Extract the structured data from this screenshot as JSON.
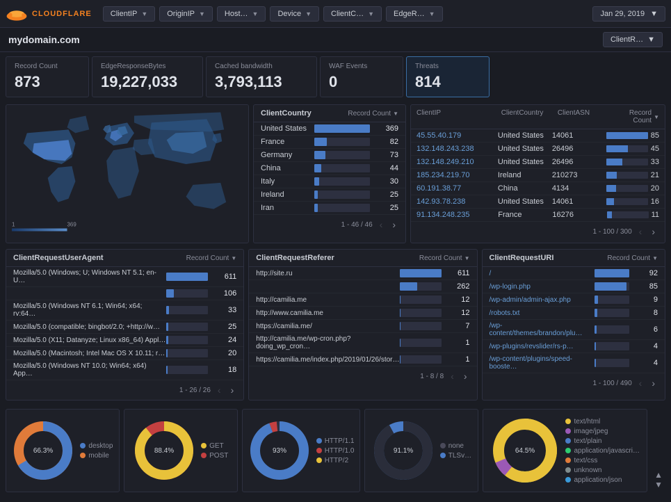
{
  "nav": {
    "logo_text": "CLOUDFLARE",
    "filters": [
      {
        "label": "ClientIP",
        "id": "clientip"
      },
      {
        "label": "OriginIP",
        "id": "originip"
      },
      {
        "label": "Host…",
        "id": "host"
      },
      {
        "label": "Device",
        "id": "device"
      },
      {
        "label": "ClientC…",
        "id": "clientc"
      },
      {
        "label": "EdgeR…",
        "id": "edger"
      }
    ],
    "date": "Jan 29, 2019"
  },
  "domain": {
    "title": "mydomain.com",
    "clientr_label": "ClientR…"
  },
  "metrics": [
    {
      "label": "Record Count",
      "value": "873",
      "highlight": false
    },
    {
      "label": "EdgeResponseBytes",
      "value": "19,227,033",
      "highlight": false
    },
    {
      "label": "Cached bandwidth",
      "value": "3,793,113",
      "highlight": false
    },
    {
      "label": "WAF Events",
      "value": "0",
      "highlight": false
    },
    {
      "label": "Threats",
      "value": "814",
      "highlight": true
    }
  ],
  "country_table": {
    "title": "ClientCountry",
    "col_header": "Record Count",
    "rows": [
      {
        "label": "United States",
        "value": 369,
        "max": 369
      },
      {
        "label": "France",
        "value": 82,
        "max": 369
      },
      {
        "label": "Germany",
        "value": 73,
        "max": 369
      },
      {
        "label": "China",
        "value": 44,
        "max": 369
      },
      {
        "label": "Italy",
        "value": 30,
        "max": 369
      },
      {
        "label": "Ireland",
        "value": 25,
        "max": 369
      },
      {
        "label": "Iran",
        "value": 25,
        "max": 369
      }
    ],
    "pagination": "1 - 46 / 46"
  },
  "clientip_table": {
    "col1": "ClientIP",
    "col2": "ClientCountry",
    "col3": "ClientASN",
    "col4": "Record Count",
    "rows": [
      {
        "ip": "45.55.40.179",
        "country": "United States",
        "asn": "14061",
        "count": 85
      },
      {
        "ip": "132.148.243.238",
        "country": "United States",
        "asn": "26496",
        "count": 45
      },
      {
        "ip": "132.148.249.210",
        "country": "United States",
        "asn": "26496",
        "count": 33
      },
      {
        "ip": "185.234.219.70",
        "country": "Ireland",
        "asn": "210273",
        "count": 21
      },
      {
        "ip": "60.191.38.77",
        "country": "China",
        "asn": "4134",
        "count": 20
      },
      {
        "ip": "142.93.78.238",
        "country": "United States",
        "asn": "14061",
        "count": 16
      },
      {
        "ip": "91.134.248.235",
        "country": "France",
        "asn": "16276",
        "count": 11
      }
    ],
    "pagination": "1 - 100 / 300"
  },
  "useragent_table": {
    "title": "ClientRequestUserAgent",
    "col_header": "Record Count",
    "rows": [
      {
        "label": "Mozilla/5.0 (Windows; U; Windows NT 5.1; en-U…",
        "value": 611,
        "max": 611
      },
      {
        "label": "",
        "value": 106,
        "max": 611
      },
      {
        "label": "Mozilla/5.0 (Windows NT 6.1; Win64; x64; rv:64…",
        "value": 33,
        "max": 611
      },
      {
        "label": "Mozilla/5.0 (compatible; bingbot/2.0; +http://w…",
        "value": 25,
        "max": 611
      },
      {
        "label": "Mozilla/5.0 (X11; Datanyze; Linux x86_64) Appl…",
        "value": 24,
        "max": 611
      },
      {
        "label": "Mozilla/5.0 (Macintosh; Intel Mac OS X 10.11; r…",
        "value": 20,
        "max": 611
      },
      {
        "label": "Mozilla/5.0 (Windows NT 10.0; Win64; x64) App…",
        "value": 18,
        "max": 611
      }
    ],
    "pagination": "1 - 26 / 26"
  },
  "referer_table": {
    "title": "ClientRequestReferer",
    "col_header": "Record Count",
    "rows": [
      {
        "label": "http://site.ru",
        "value": 611,
        "max": 611
      },
      {
        "label": "",
        "value": 262,
        "max": 611
      },
      {
        "label": "http://camilia.me",
        "value": 12,
        "max": 611
      },
      {
        "label": "http://www.camilia.me",
        "value": 12,
        "max": 611
      },
      {
        "label": "https://camilia.me/",
        "value": 7,
        "max": 611
      },
      {
        "label": "http://camilia.me/wp-cron.php?doing_wp_cron…",
        "value": 1,
        "max": 611
      },
      {
        "label": "https://camilia.me/index.php/2019/01/26/stor…",
        "value": 1,
        "max": 611
      }
    ],
    "pagination": "1 - 8 / 8"
  },
  "uri_table": {
    "title": "ClientRequestURI",
    "col_header": "Record Count",
    "rows": [
      {
        "label": "/",
        "value": 92,
        "max": 92
      },
      {
        "label": "/wp-login.php",
        "value": 85,
        "max": 92
      },
      {
        "label": "/wp-admin/admin-ajax.php",
        "value": 9,
        "max": 92
      },
      {
        "label": "/robots.txt",
        "value": 8,
        "max": 92
      },
      {
        "label": "/wp-content/themes/brandon/plu…",
        "value": 6,
        "max": 92
      },
      {
        "label": "/wp-plugins/revslider/rs-p…",
        "value": 4,
        "max": 92
      },
      {
        "label": "/wp-content/plugins/speed-booste…",
        "value": 4,
        "max": 92
      }
    ],
    "pagination": "1 - 100 / 490"
  },
  "charts": {
    "device": {
      "segments": [
        {
          "label": "desktop",
          "value": 66.3,
          "color": "#4a7cc7"
        },
        {
          "label": "mobile",
          "value": 33.7,
          "color": "#e07b3a"
        }
      ],
      "center_label": "66.3%"
    },
    "method": {
      "segments": [
        {
          "label": "GET",
          "value": 88.4,
          "color": "#e8c23a"
        },
        {
          "label": "POST",
          "value": 11.6,
          "color": "#c44040"
        }
      ],
      "center_label": "88.4%"
    },
    "http_version": {
      "segments": [
        {
          "label": "HTTP/1.1",
          "value": 93,
          "color": "#4a7cc7"
        },
        {
          "label": "HTTP/1.0",
          "value": 4,
          "color": "#c44040"
        },
        {
          "label": "HTTP/2",
          "value": 3,
          "color": "#e8c23a"
        }
      ],
      "center_label": "93%"
    },
    "tls": {
      "segments": [
        {
          "label": "none",
          "value": 91.1,
          "color": "#2a2d3a"
        },
        {
          "label": "TLSv…",
          "value": 8.9,
          "color": "#4a7cc7"
        }
      ],
      "center_label": "91.1%"
    },
    "content_type": {
      "segments": [
        {
          "label": "text/html",
          "value": 64.5,
          "color": "#e8c23a"
        },
        {
          "label": "image/jpeg",
          "value": 8,
          "color": "#9b59b6"
        },
        {
          "label": "text/plain",
          "value": 6,
          "color": "#4a7cc7"
        },
        {
          "label": "application/javascri…",
          "value": 5,
          "color": "#2ecc71"
        },
        {
          "label": "text/css",
          "value": 5,
          "color": "#e07b3a"
        },
        {
          "label": "unknown",
          "value": 7,
          "color": "#7f8c8d"
        },
        {
          "label": "application/json",
          "value": 4.5,
          "color": "#3a9ad9"
        }
      ],
      "center_label": "64.5%"
    }
  },
  "scroll": {
    "up": "▲",
    "down": "▼"
  }
}
